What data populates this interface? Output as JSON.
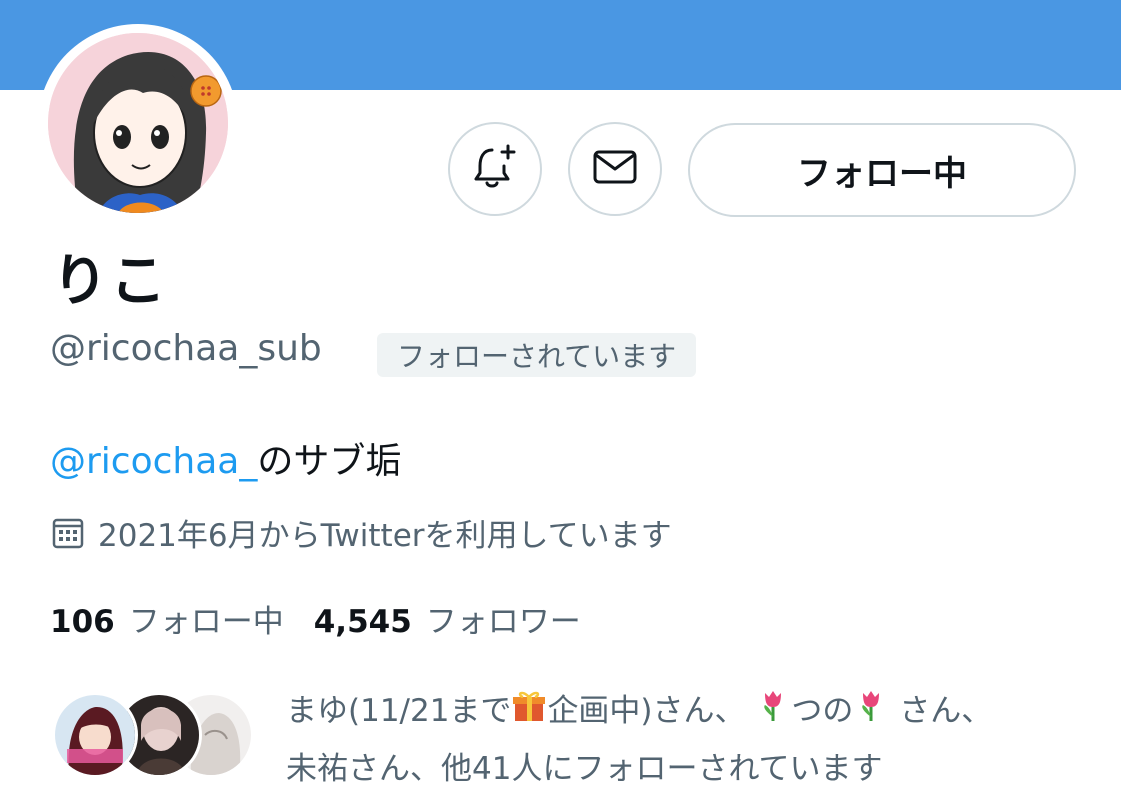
{
  "profile": {
    "display_name": "りこ",
    "handle": "@ricochaa_sub",
    "follows_you_badge": "フォローされています",
    "bio_mention": "@ricochaa_",
    "bio_rest": "のサブ垢",
    "joined_text": "2021年6月からTwitterを利用しています"
  },
  "actions": {
    "notify_icon": "bell-plus-icon",
    "message_icon": "envelope-icon",
    "follow_label": "フォロー中"
  },
  "stats": {
    "following_count": "106",
    "following_label": "フォロー中",
    "followers_count": "4,545",
    "followers_label": "フォロワー"
  },
  "mutuals": {
    "line1_a": "まゆ(11/21まで",
    "line1_b": "企画中)さん、",
    "line1_c": "つの",
    "line1_d": "さん、",
    "line2": "未祐さん、他41人にフォローされています"
  },
  "colors": {
    "banner": "#4a97e3",
    "accent": "#1d9bf0",
    "muted": "#536471",
    "border": "#cfd9de"
  }
}
